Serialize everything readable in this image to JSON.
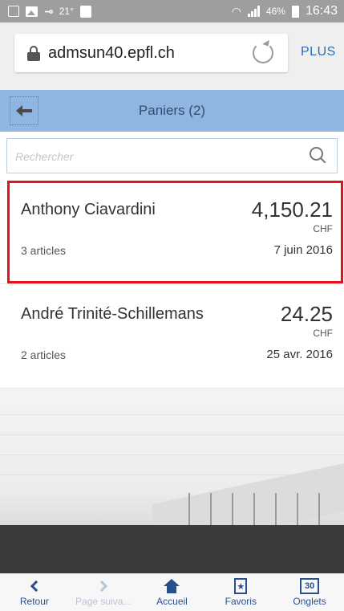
{
  "status_bar": {
    "temperature": "21°",
    "battery_percent": "46%",
    "time": "16:43",
    "icons": [
      "notes-icon",
      "image-icon",
      "key-icon",
      "clipboard-icon",
      "wifi-icon",
      "signal-icon",
      "battery-icon"
    ]
  },
  "browser": {
    "url": "admsun40.epfl.ch",
    "menu_label": "PLUS"
  },
  "header": {
    "title": "Paniers (2)"
  },
  "search": {
    "placeholder": "Rechercher",
    "value": ""
  },
  "baskets": [
    {
      "name": "Anthony Ciavardini",
      "amount": "4,150.21",
      "currency": "CHF",
      "count": "3 articles",
      "date": "7 juin 2016",
      "selected": true
    },
    {
      "name": "André Trinité-Schillemans",
      "amount": "24.25",
      "currency": "CHF",
      "count": "2 articles",
      "date": "25 avr. 2016",
      "selected": false
    }
  ],
  "toolbar": {
    "back_label": "Retour",
    "next_label": "Page suiva...",
    "home_label": "Accueil",
    "favorites_label": "Favoris",
    "tabs_label": "Onglets",
    "tabs_count": "30"
  },
  "colors": {
    "header_bg": "#8fb6e0",
    "status_bar": "#9e9e9e",
    "selection_border": "#e4101b",
    "link": "#2a6db5",
    "toolbar_icon": "#2a4f8f"
  }
}
